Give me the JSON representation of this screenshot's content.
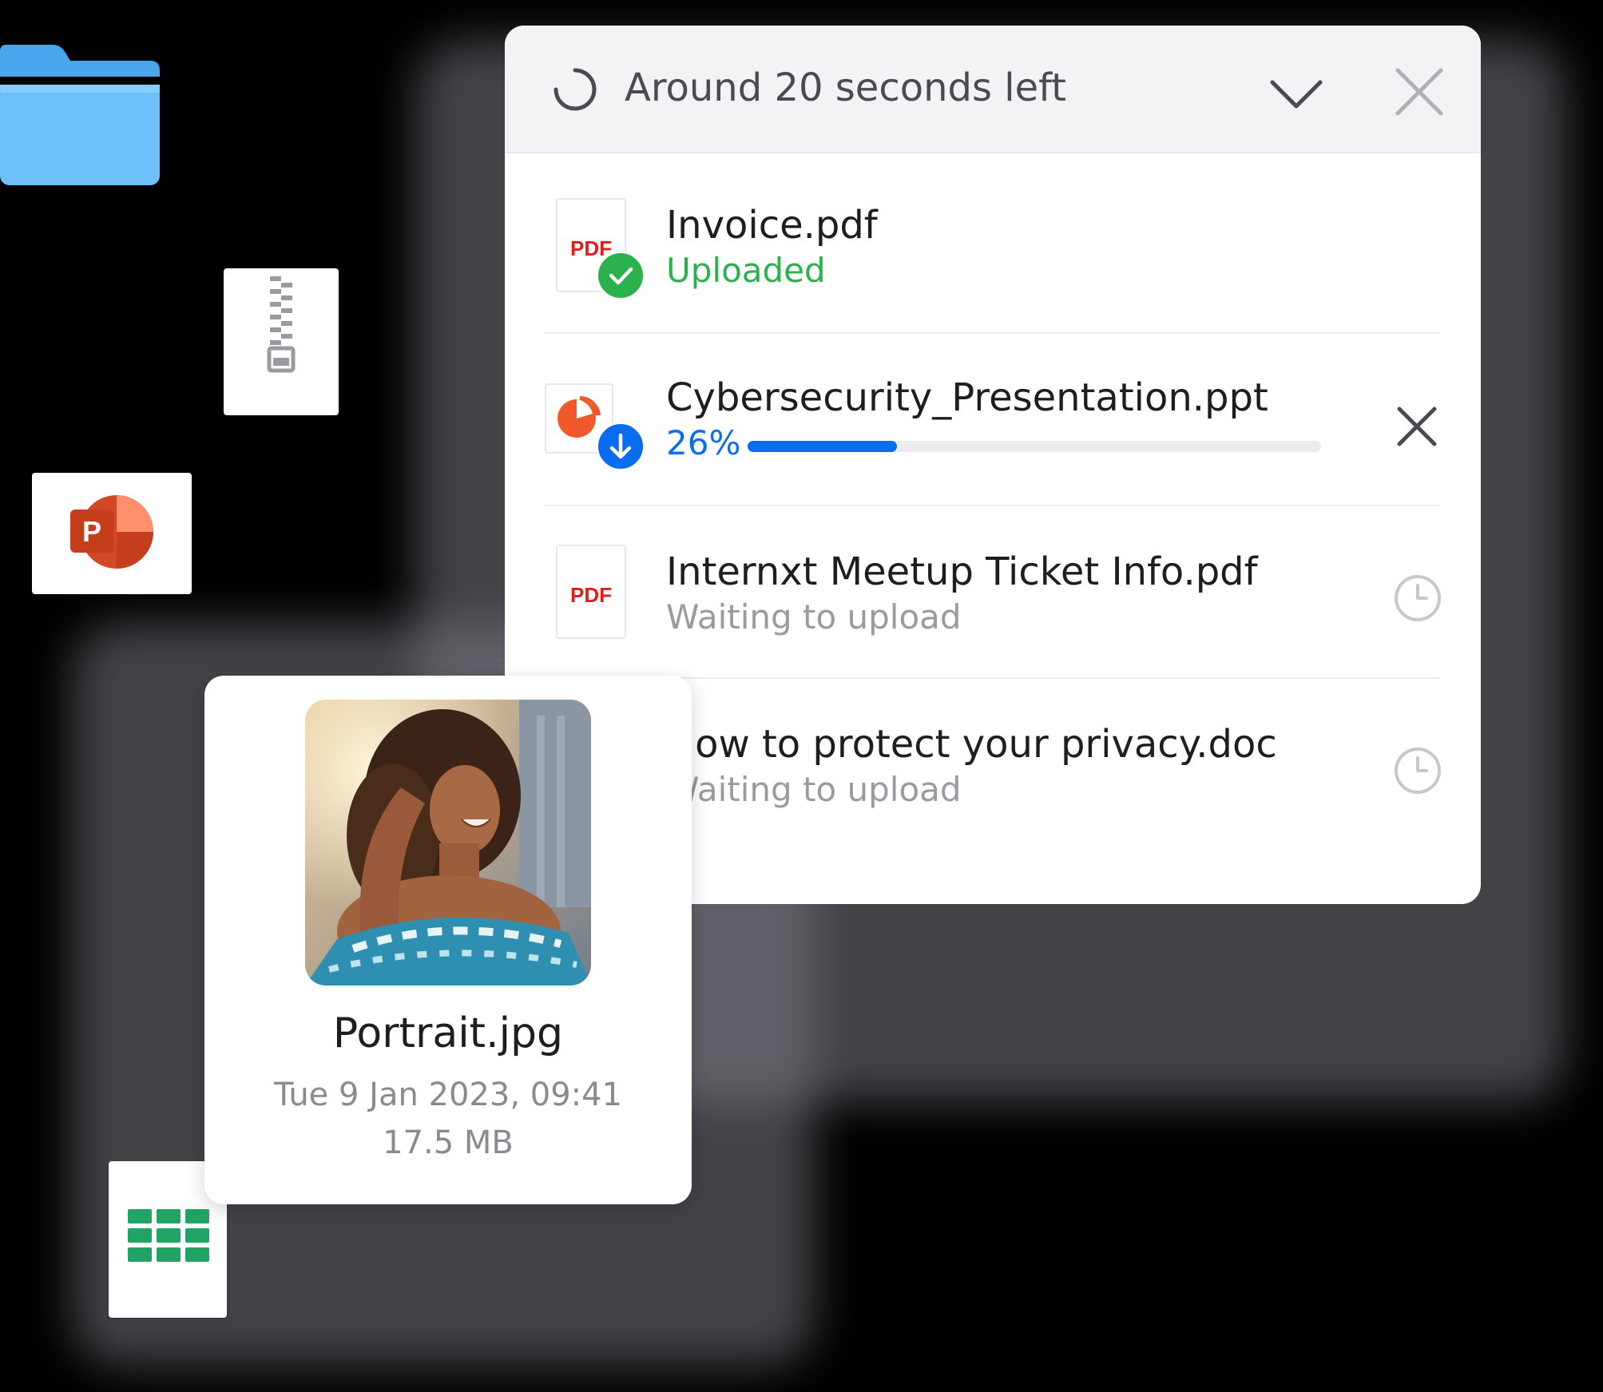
{
  "upload_panel": {
    "header": {
      "title": "Around 20 seconds left",
      "collapse_icon": "chevron-down-icon",
      "close_icon": "close-icon"
    },
    "items": [
      {
        "file_name": "Invoice.pdf",
        "status": "Uploaded",
        "file_type": "PDF",
        "badge_icon": "check-icon",
        "status_color": "#2bb24c"
      },
      {
        "file_name": "Cybersecurity_Presentation.ppt",
        "progress_label": "26%",
        "progress": 0.26,
        "badge_icon": "download-arrow-icon",
        "action_icon": "close-icon",
        "accent_color": "#0a6cf0"
      },
      {
        "file_name": "Internxt Meetup Ticket Info.pdf",
        "status": "Waiting to upload",
        "file_type": "PDF",
        "action_icon": "clock-icon"
      },
      {
        "file_name": "How to protect your privacy.doc",
        "status": "Waiting to upload",
        "action_icon": "clock-icon"
      }
    ]
  },
  "portrait_card": {
    "file_name": "Portrait.jpg",
    "date": "Tue 9 Jan 2023, 09:41",
    "size": "17.5 MB"
  },
  "floating_icons": [
    "folder-icon",
    "zip-file-icon",
    "powerpoint-icon",
    "spreadsheet-icon"
  ]
}
